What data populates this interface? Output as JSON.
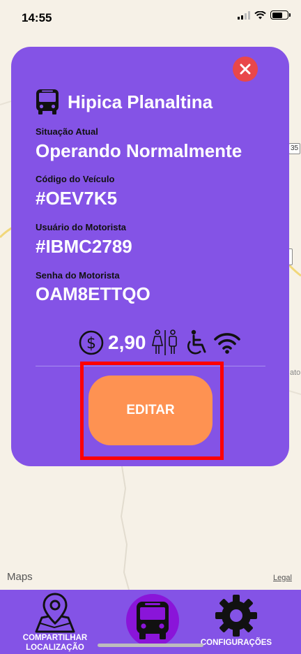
{
  "status_bar": {
    "time": "14:55"
  },
  "map": {
    "route_number": "35",
    "partial_label": "ato",
    "maps_brand": "Maps",
    "legal": "Legal"
  },
  "card": {
    "title": "Hipica Planaltina",
    "fields": [
      {
        "label": "Situação Atual",
        "value": "Operando Normalmente"
      },
      {
        "label": "Código do Veículo",
        "value": "#OEV7K5"
      },
      {
        "label": "Usuário do Motorista",
        "value": "#IBMC2789"
      },
      {
        "label": "Senha do Motorista",
        "value": "OAM8ETTQO"
      }
    ],
    "price": "2,90",
    "edit_label": "EDITAR"
  },
  "tabbar": {
    "share_label_line1": "COMPARTILHAR",
    "share_label_line2": "LOCALIZAÇÃO",
    "settings_label": "CONFIGURAÇÕES"
  },
  "colors": {
    "card": "#8453e6",
    "edit_button": "#fe9252",
    "close_button": "#e9474a",
    "highlight": "#ff0000",
    "tab_active": "#8a15d9"
  }
}
